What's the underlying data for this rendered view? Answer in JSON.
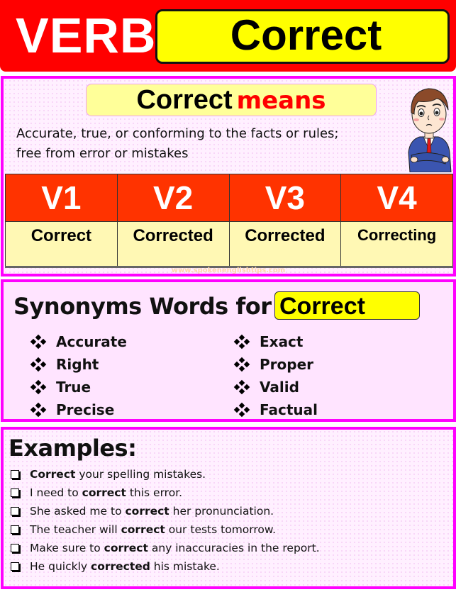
{
  "header": {
    "label": "VERB",
    "word": "Correct"
  },
  "meaning": {
    "word": "Correct",
    "suffix": "means",
    "definition_line1": "Accurate, true, or conforming to the facts or rules;",
    "definition_line2": "free from error or mistakes",
    "illustration": "thinking-businessman-icon"
  },
  "forms": {
    "headers": [
      "V1",
      "V2",
      "V3",
      "V4"
    ],
    "values": [
      "Correct",
      "Corrected",
      "Corrected",
      "Correcting"
    ]
  },
  "watermark": "www.spokenenglishtips.com",
  "synonyms": {
    "title": "Synonyms Words for",
    "word": "Correct",
    "left": [
      "Accurate",
      "Right",
      "True",
      "Precise"
    ],
    "right": [
      "Exact",
      "Proper",
      "Valid",
      "Factual"
    ]
  },
  "examples": {
    "title": "Examples:",
    "items": [
      {
        "before": "",
        "bold": "Correct",
        "after": " your spelling mistakes."
      },
      {
        "before": "I need to ",
        "bold": "correct",
        "after": " this error."
      },
      {
        "before": "She asked me to ",
        "bold": "correct",
        "after": " her pronunciation."
      },
      {
        "before": "The teacher will ",
        "bold": "correct",
        "after": " our tests tomorrow."
      },
      {
        "before": "Make sure to ",
        "bold": "correct",
        "after": " any inaccuracies in the report."
      },
      {
        "before": "He quickly ",
        "bold": "corrected",
        "after": " his mistake."
      }
    ]
  },
  "colors": {
    "header_red": "#ff0000",
    "highlight_yellow": "#ffff00",
    "panel_border": "#ff00ff",
    "table_header": "#ff3300",
    "means_red": "#ff0000"
  }
}
